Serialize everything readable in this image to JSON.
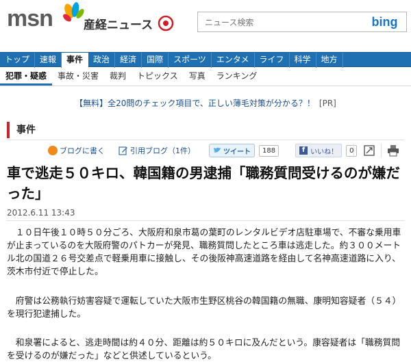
{
  "header": {
    "logo": "msn",
    "site_name": "産経ニュース",
    "search_placeholder": "ニュース検索",
    "search_button": "bing"
  },
  "nav": {
    "items": [
      "トップ",
      "速報",
      "事件",
      "政治",
      "経済",
      "国際",
      "スポーツ",
      "エンタメ",
      "ライフ",
      "科学",
      "地方"
    ],
    "active": "事件"
  },
  "subnav": {
    "items": [
      "犯罪・疑惑",
      "事故・災害",
      "裁判",
      "トピックス",
      "写真",
      "ランキング"
    ],
    "active": "犯罪・疑惑"
  },
  "ad": {
    "text": "【無料】全20問のチェック項目で、正しい薄毛対策が分かる？！",
    "tag": "[PR]"
  },
  "section": {
    "title": "事件"
  },
  "share": {
    "blog_label": "ブログに書く",
    "quote_label": "引用ブログ（1件）",
    "tweet_label": "ツイート",
    "tweet_count": "188",
    "like_label": "いいね！",
    "like_count": "0"
  },
  "article": {
    "headline": "車で逃走５０キロ、韓国籍の男逮捕「職務質問受けるのが嫌だった」",
    "date": "2012.6.11 13:43",
    "paragraphs": [
      "　１０日午後１０時５０分ごろ、大阪府和泉市葛の葉町のレンタルビデオ店駐車場で、不審な乗用車が止まっているのを大阪府警のパトカーが発見、職務質問したところ車は逃走した。約３００メートル北の国道２６号交差点で軽乗用車に接触し、その後阪神高速道路を経由して名神高速道路に入り、茨木市付近で停止した。",
      "　府警は公務執行妨害容疑で運転していた大阪市生野区桃谷の韓国籍の無職、康明知容疑者（５４）を現行犯逮捕した。",
      "　和泉署によると、逃走時間は約４０分、距離は約５０キロに及んだという。康容疑者は「職務質問を受けるのが嫌だった」などと供述しているという。"
    ]
  },
  "colors": {
    "nav_bg": "#1f6fb3",
    "section_accent": "#c8262c",
    "link": "#1a4d8f"
  }
}
